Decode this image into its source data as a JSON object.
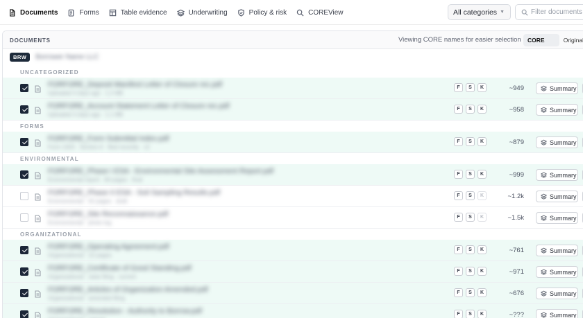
{
  "tabs": [
    {
      "label": "Documents",
      "icon": "document-icon",
      "active": true
    },
    {
      "label": "Forms",
      "icon": "form-icon",
      "active": false
    },
    {
      "label": "Table evidence",
      "icon": "table-icon",
      "active": false
    },
    {
      "label": "Underwriting",
      "icon": "layers-icon",
      "active": false
    },
    {
      "label": "Policy & risk",
      "icon": "shield-icon",
      "active": false
    },
    {
      "label": "COREView",
      "icon": "search-icon",
      "active": false
    }
  ],
  "category_select": {
    "value": "All categories"
  },
  "filter": {
    "placeholder": "Filter documents"
  },
  "panel": {
    "title": "DOCUMENTS",
    "viewing_text": "Viewing CORE names for easier selection",
    "toggle": {
      "core": "CORE name",
      "original": "Original"
    }
  },
  "borrower": {
    "badge": "BRW",
    "name": "Borrower Name LLC"
  },
  "sections": [
    "UNCATEGORIZED",
    "FORMS",
    "ENVIRONMENTAL",
    "ORGANIZATIONAL"
  ],
  "rows": [
    {
      "checked": true,
      "name": "FORFORE_Deposit Manifest Letter of Closure rec.pdf",
      "meta": "Uploaded 3 days ago · 1.2 MB",
      "tokens": "~949",
      "k_active": true,
      "summary": "Summary"
    },
    {
      "checked": true,
      "name": "FORFORE_Account Statement Letter of Closure rec.pdf",
      "meta": "Uploaded 3 days ago · 1.1 MB",
      "tokens": "~958",
      "k_active": true,
      "summary": "Summary"
    },
    {
      "checked": true,
      "name": "FORFORE_Form Submittal Index.pdf",
      "meta": "Form 1003 · Section A · filed recently · v2",
      "tokens": "~879",
      "k_active": true,
      "summary": "Summary"
    },
    {
      "checked": true,
      "name": "FORFORE_Phase I ESA - Environmental Site Assessment Report.pdf",
      "meta": "Environmental report · 84 pages · final",
      "tokens": "~999",
      "k_active": true,
      "summary": "Summary"
    },
    {
      "checked": false,
      "name": "FORFORE_Phase II ESA - Soil Sampling Results.pdf",
      "meta": "Environmental · 42 pages · draft",
      "tokens": "~1.2k",
      "k_active": false,
      "summary": "Summary"
    },
    {
      "checked": false,
      "name": "FORFORE_Site Reconnaissance.pdf",
      "meta": "Environmental · photo log",
      "tokens": "~1.5k",
      "k_active": false,
      "summary": "Summary"
    },
    {
      "checked": true,
      "name": "FORFORE_Operating Agreement.pdf",
      "meta": "Organizational · 22 pages",
      "tokens": "~761",
      "k_active": true,
      "summary": "Summary"
    },
    {
      "checked": true,
      "name": "FORFORE_Certificate of Good Standing.pdf",
      "meta": "Organizational · state filing · current",
      "tokens": "~971",
      "k_active": true,
      "summary": "Summary"
    },
    {
      "checked": true,
      "name": "FORFORE_Articles of Organization Amended.pdf",
      "meta": "Organizational · amended filing",
      "tokens": "~676",
      "k_active": true,
      "summary": "Summary"
    },
    {
      "checked": true,
      "name": "FORFORE_Resolution - Authority to Borrow.pdf",
      "meta": "Organizational · signed",
      "tokens": "~???",
      "k_active": true,
      "summary": "Summary"
    }
  ],
  "badge_letters": [
    "F",
    "S",
    "K"
  ],
  "colors": {
    "selected_row": "#eefaf6",
    "checkbox": "#1c2738",
    "brw_badge": "#1d2a3a"
  }
}
